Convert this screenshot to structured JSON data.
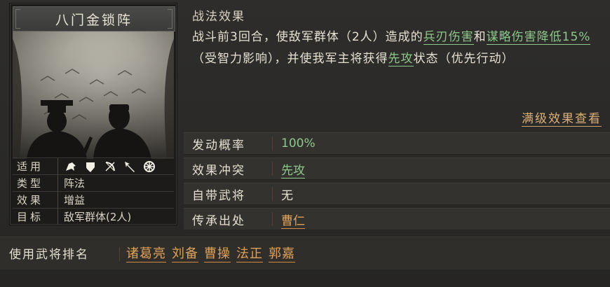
{
  "card": {
    "title": "八门金锁阵",
    "rows": [
      {
        "label": "适用",
        "value": ""
      },
      {
        "label": "类型",
        "value": "阵法"
      },
      {
        "label": "效果",
        "value": "增益"
      },
      {
        "label": "目标",
        "value": "敌军群体(2人)"
      }
    ],
    "troop_icons": [
      "cavalry-icon",
      "shield-icon",
      "bow-icon",
      "spear-icon",
      "wheel-icon"
    ]
  },
  "effect": {
    "title": "战法效果",
    "text_parts": [
      {
        "t": "战斗前3回合，使敌军群体（2人）造成的",
        "hl": false
      },
      {
        "t": "兵刃伤害",
        "hl": true
      },
      {
        "t": "和",
        "hl": false
      },
      {
        "t": "谋略伤害降低15%",
        "hl": true
      },
      {
        "t": "（受智力影响），并使我军主将获得",
        "hl": false
      },
      {
        "t": "先攻",
        "hl": true
      },
      {
        "t": "状态（优先行动）",
        "hl": false
      }
    ],
    "full_effect_link": "满级效果查看"
  },
  "attributes": [
    {
      "label": "发动概率",
      "value": "100%",
      "style": "green"
    },
    {
      "label": "效果冲突",
      "value": "先攻",
      "style": "greenu"
    },
    {
      "label": "自带武将",
      "value": "无",
      "style": "white"
    },
    {
      "label": "传承出处",
      "value": "曹仁",
      "style": "orangeu"
    }
  ],
  "ranking": {
    "label": "使用武将排名",
    "names": [
      "诸葛亮",
      "刘备",
      "曹操",
      "法正",
      "郭嘉"
    ]
  },
  "colors": {
    "accent_green": "#8cc88a",
    "accent_orange": "#e0a25a",
    "background": "#2b2a28"
  }
}
